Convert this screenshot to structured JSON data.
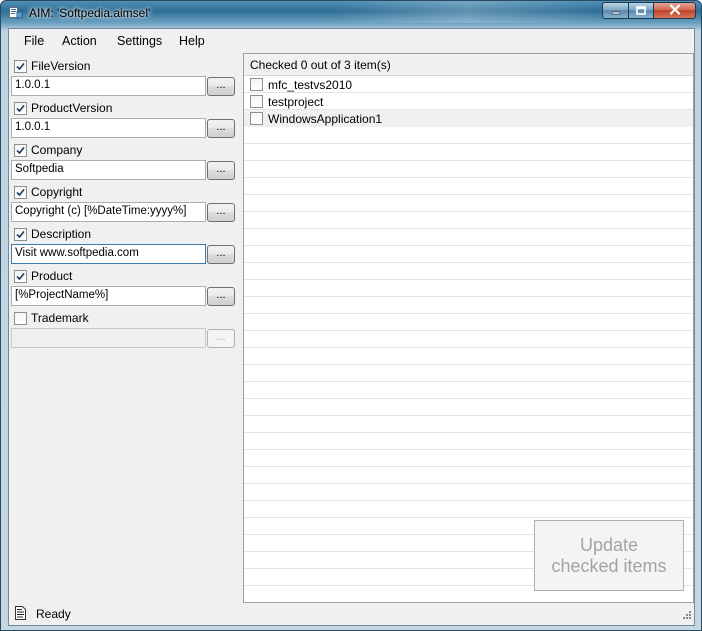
{
  "window": {
    "title": "AIM: 'Softpedia.aimsel'",
    "icons": {
      "app": "app-icon",
      "minimize": "minimize-icon",
      "maximize": "maximize-icon",
      "close": "close-icon"
    }
  },
  "menu": {
    "items": [
      {
        "label": "File"
      },
      {
        "label": "Action"
      },
      {
        "label": "Settings"
      },
      {
        "label": "Help"
      }
    ]
  },
  "fields": [
    {
      "label": "FileVersion",
      "checked": true,
      "value": "1.0.0.1",
      "button": "..."
    },
    {
      "label": "ProductVersion",
      "checked": true,
      "value": "1.0.0.1",
      "button": "..."
    },
    {
      "label": "Company",
      "checked": true,
      "value": "Softpedia",
      "button": "..."
    },
    {
      "label": "Copyright",
      "checked": true,
      "value": "Copyright (c) [%DateTime:yyyy%]",
      "button": "..."
    },
    {
      "label": "Description",
      "checked": true,
      "value": "Visit www.softpedia.com",
      "button": "...",
      "focused": true
    },
    {
      "label": "Product",
      "checked": true,
      "value": "[%ProjectName%]",
      "button": "..."
    },
    {
      "label": "Trademark",
      "checked": false,
      "value": "",
      "button": "...",
      "disabled": true
    }
  ],
  "project_list": {
    "header": "Checked 0 out of 3 item(s)",
    "items": [
      {
        "label": "mfc_testvs2010",
        "checked": false
      },
      {
        "label": "testproject",
        "checked": false
      },
      {
        "label": "WindowsApplication1",
        "checked": false
      }
    ]
  },
  "update_button": {
    "line1": "Update",
    "line2": "checked items",
    "enabled": false
  },
  "status": {
    "text": "Ready",
    "icon": "document-icon"
  },
  "colors": {
    "title_bar": "#2e6e96",
    "close_button": "#c0412a",
    "client_bg": "#f0f0f0",
    "disabled_text": "#a3a3a3"
  }
}
